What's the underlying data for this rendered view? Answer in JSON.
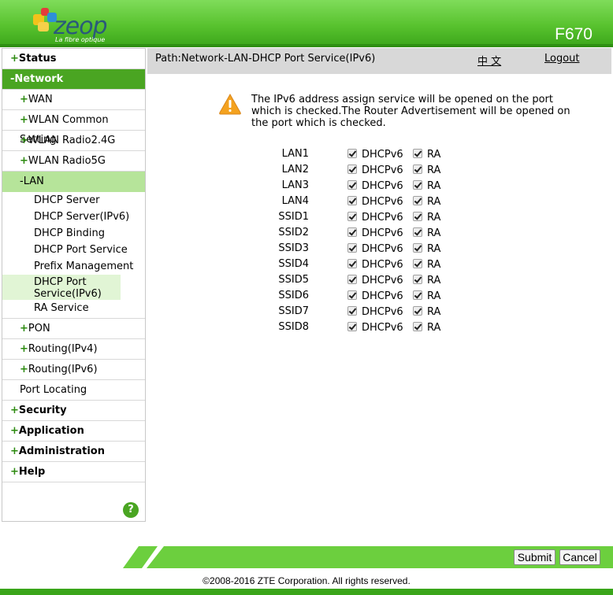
{
  "header": {
    "brand": "zeop",
    "tagline": "La fibre optique",
    "model": "F670"
  },
  "sidebar": {
    "items": [
      {
        "label": "Status",
        "sign": "+"
      },
      {
        "label": "Network",
        "sign": "-"
      },
      {
        "label": "WAN",
        "sign": "+"
      },
      {
        "label": "WLAN Common Setting",
        "sign": "+"
      },
      {
        "label": "WLAN Radio2.4G",
        "sign": "+"
      },
      {
        "label": "WLAN Radio5G",
        "sign": "+"
      },
      {
        "label": "LAN",
        "sign": "-"
      },
      {
        "label": "PON",
        "sign": "+"
      },
      {
        "label": "Routing(IPv4)",
        "sign": "+"
      },
      {
        "label": "Routing(IPv6)",
        "sign": "+"
      },
      {
        "label": "Port Locating",
        "sign": ""
      },
      {
        "label": "Security",
        "sign": "+"
      },
      {
        "label": "Application",
        "sign": "+"
      },
      {
        "label": "Administration",
        "sign": "+"
      },
      {
        "label": "Help",
        "sign": "+"
      }
    ],
    "lan_sub": [
      "DHCP Server",
      "DHCP Server(IPv6)",
      "DHCP Binding",
      "DHCP Port Service",
      "Prefix Management",
      "DHCP Port Service(IPv6)",
      "RA Service"
    ],
    "help_label": "?"
  },
  "pathbar": {
    "path": "Path:Network-LAN-DHCP Port Service(IPv6)",
    "language": "中 文",
    "logout": "Logout"
  },
  "notice": "The IPv6 address assign service will be opened on the port which is checked.The Router Advertisement will be opened on the port which is checked.",
  "ports": [
    {
      "name": "LAN1",
      "dhcpv6": true,
      "ra": true
    },
    {
      "name": "LAN2",
      "dhcpv6": true,
      "ra": true
    },
    {
      "name": "LAN3",
      "dhcpv6": true,
      "ra": true
    },
    {
      "name": "LAN4",
      "dhcpv6": true,
      "ra": true
    },
    {
      "name": "SSID1",
      "dhcpv6": true,
      "ra": true
    },
    {
      "name": "SSID2",
      "dhcpv6": true,
      "ra": true
    },
    {
      "name": "SSID3",
      "dhcpv6": true,
      "ra": true
    },
    {
      "name": "SSID4",
      "dhcpv6": true,
      "ra": true
    },
    {
      "name": "SSID5",
      "dhcpv6": true,
      "ra": true
    },
    {
      "name": "SSID6",
      "dhcpv6": true,
      "ra": true
    },
    {
      "name": "SSID7",
      "dhcpv6": true,
      "ra": true
    },
    {
      "name": "SSID8",
      "dhcpv6": true,
      "ra": true
    }
  ],
  "labels": {
    "dhcpv6": "DHCPv6",
    "ra": "RA"
  },
  "buttons": {
    "submit": "Submit",
    "cancel": "Cancel"
  },
  "footer": {
    "copyright": "©2008-2016 ZTE Corporation. All rights reserved."
  },
  "colors": {
    "primary_green": "#4aa522",
    "active_sub_bg": "#b6e49a",
    "warning": "#f4a21f"
  }
}
